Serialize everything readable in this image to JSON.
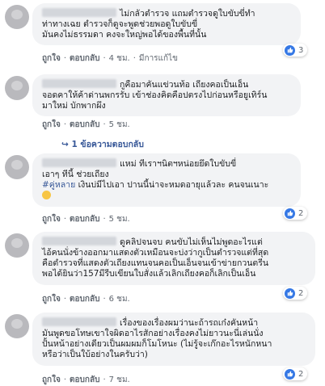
{
  "comments": [
    {
      "lines": [
        "ไม่กลัวตำรวจ แถมตำรวจดูใบขับขี่ทำ",
        "ท่าทางเฉย ตำรวจก็ดูจะพูดช่วยพอดูใบขับขี่",
        "มันคงไม่ธรรมดา คงจะใหญ่พอได้ของพื้นที่นั้น"
      ],
      "like": "ถูกใจ",
      "reply": "ตอบกลับ",
      "time": "4 ชม.",
      "edited": "มีการแก้ไข",
      "reactions": "3"
    },
    {
      "lines": [
        "กูคือมาคันแข่วนท้อ เถียงคอเป็นเอ็น",
        "จอดคาให้ค้าด่านพกรรับ เข้าช่องคิดคือปตรงไปก่อนหรือยูเทิร์น",
        "มาใหม่ บักพากผึง"
      ],
      "like": "ถูกใจ",
      "reply": "ตอบกลับ",
      "time": "5 ชม.",
      "replies_label": "1 ข้อความตอบกลับ"
    },
    {
      "lines_before_tag": [
        "แหม่ ทีเราฯนิตฯหน่อยยึดใบขับขี่",
        "เอาๆ ทีนี้ ช่วยเถียง"
      ],
      "tag": "#คู่หลาย",
      "tag_rest": " เงินบ่มีไปเอา ปานนี้น่าจะหมดอายุแล้วละ คนจนเนาะ",
      "like": "ถูกใจ",
      "reply": "ตอบกลับ",
      "time": "5 ชม.",
      "reactions": "2"
    },
    {
      "lines": [
        "ดูคลิปจนจบ คนขับไม่เห็นไม่พูดอะไรแต่",
        "ไอ้คนนั่งข้างออกมาแสดงตัวเหมือนจะบ่งว่ากูเป็นตำรวจแต่ที่สุด",
        "คือตำรวจที่แสดงตัวเถียงแทนจนคอเป็นเอ็นจนเข้าข่ายกวนตรีน",
        "พอได้ยินว่า157มีรีบเขียนใบสั่งแล้วเลิกเถียงคอก็เลิกเป็นเอ็น"
      ],
      "like": "ถูกใจ",
      "reply": "ตอบกลับ",
      "time": "6 ชม.",
      "reactions": "2"
    },
    {
      "lines": [
        "เรื่องของเรื่องผมว่านะถ้ารถเก๋งคันหน้า",
        "มันพูดขอโทษเขาใจผิดอาไรสักอย่างเรื่องคงไม่ยาวนะนี่เล่นนั่ง",
        "ปั้นหน้าอย่างเดียวเป็นผมผมก็โมโหนะ (ไม่รู้จะเก๊กอะไรหนักหนา",
        "หรือว่าเป็นใบ้อย่างในครับว่า)"
      ],
      "like": "ถูกใจ",
      "reply": "ตอบกลับ",
      "time": "7 ชม.",
      "reactions": "2"
    }
  ]
}
